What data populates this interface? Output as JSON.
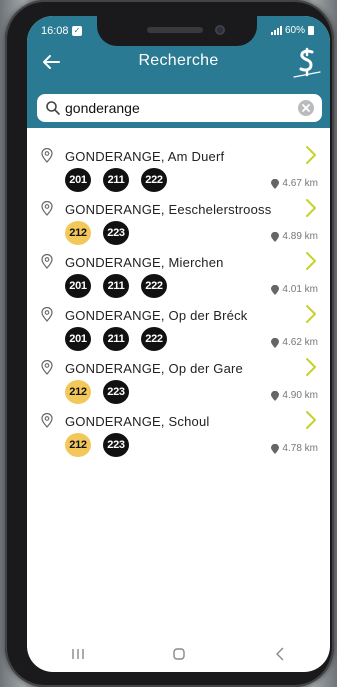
{
  "status_bar": {
    "time": "16:08",
    "battery": "60%"
  },
  "header": {
    "title": "Recherche",
    "back_icon": "arrow-left-icon",
    "logo_icon": "app-logo-icon"
  },
  "search": {
    "value": "gonderange",
    "placeholder": ""
  },
  "colors": {
    "header": "#2a7a93",
    "badge_black": "#111111",
    "badge_yellow": "#f3c85a",
    "chevron": "#c7d22a"
  },
  "results": [
    {
      "name": "GONDERANGE, Am Duerf",
      "lines": [
        {
          "num": "201",
          "color": "black"
        },
        {
          "num": "211",
          "color": "black"
        },
        {
          "num": "222",
          "color": "black"
        }
      ],
      "distance": "4.67 km"
    },
    {
      "name": "GONDERANGE, Eeschelerstrooss",
      "lines": [
        {
          "num": "212",
          "color": "yellow"
        },
        {
          "num": "223",
          "color": "black"
        }
      ],
      "distance": "4.89 km"
    },
    {
      "name": "GONDERANGE, Mierchen",
      "lines": [
        {
          "num": "201",
          "color": "black"
        },
        {
          "num": "211",
          "color": "black"
        },
        {
          "num": "222",
          "color": "black"
        }
      ],
      "distance": "4.01 km"
    },
    {
      "name": "GONDERANGE, Op der Bréck",
      "lines": [
        {
          "num": "201",
          "color": "black"
        },
        {
          "num": "211",
          "color": "black"
        },
        {
          "num": "222",
          "color": "black"
        }
      ],
      "distance": "4.62 km"
    },
    {
      "name": "GONDERANGE, Op der Gare",
      "lines": [
        {
          "num": "212",
          "color": "yellow"
        },
        {
          "num": "223",
          "color": "black"
        }
      ],
      "distance": "4.90 km"
    },
    {
      "name": "GONDERANGE, Schoul",
      "lines": [
        {
          "num": "212",
          "color": "yellow"
        },
        {
          "num": "223",
          "color": "black"
        }
      ],
      "distance": "4.78 km"
    }
  ]
}
